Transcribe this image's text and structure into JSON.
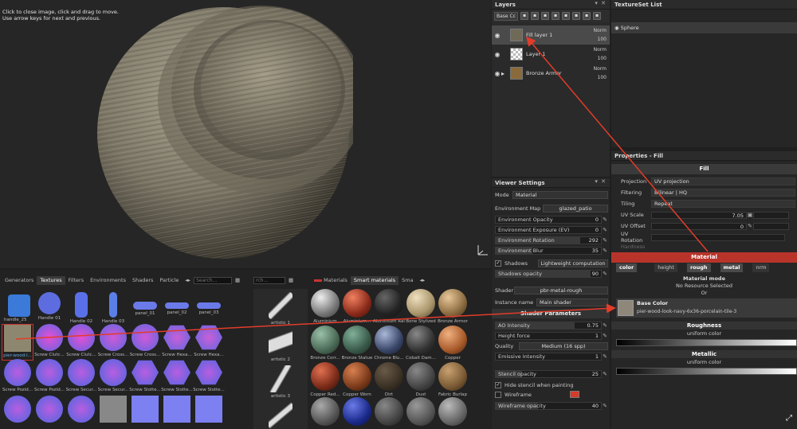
{
  "viewport": {
    "hint_line1": "Click to close image, click and drag to move.",
    "hint_line2": "Use arrow keys for next and previous."
  },
  "layers": {
    "title": "Layers",
    "blend_mode": "Base Cc",
    "items": [
      {
        "name": "Fill layer 1",
        "blend": "Norm",
        "opacity": "100",
        "selected": true
      },
      {
        "name": "Layer 1",
        "blend": "Norm",
        "opacity": "100",
        "selected": false
      },
      {
        "name": "Bronze Armor",
        "blend": "Norm",
        "opacity": "100",
        "selected": false
      }
    ]
  },
  "texset": {
    "title": "TextureSet List",
    "items": [
      "Sphere"
    ]
  },
  "properties": {
    "title": "Properties - Fill",
    "fill_head": "Fill",
    "projection_label": "Projection",
    "projection_value": "UV projection",
    "filtering_label": "Filtering",
    "filtering_value": "Bilinear | HQ",
    "tiling_label": "Tiling",
    "tiling_value": "Repeat",
    "uvscale_label": "UV Scale",
    "uvscale_value": "7.05",
    "uvoffset_label": "UV Offset",
    "uvoffset_value": "0",
    "uvrotation_label": "UV Rotation",
    "hardness_label": "Hardness",
    "material_head": "Material",
    "channels": [
      "color",
      "height",
      "rough",
      "metal",
      "nrm"
    ],
    "material_mode_label": "Material mode",
    "material_mode_value": "No Resource Selected",
    "or_label": "Or",
    "basecolor_label": "Base Color",
    "basecolor_file": "pier-wood-look-navy-6x36-porcelain-tile-3",
    "roughness_label": "Roughness",
    "roughness_sub": "uniform color",
    "metallic_label": "Metallic",
    "metallic_sub": "uniform color"
  },
  "viewer": {
    "title": "Viewer Settings",
    "mode_label": "Mode",
    "mode_value": "Material",
    "envmap_label": "Environment Map",
    "envmap_value": "glazed_patio",
    "env_opacity_label": "Environment Opacity",
    "env_opacity_value": "0",
    "env_exposure_label": "Environment Exposure (EV)",
    "env_exposure_value": "0",
    "env_rotation_label": "Environment Rotation",
    "env_rotation_value": "292",
    "env_blur_label": "Environment Blur",
    "env_blur_value": "35",
    "shadows_label": "Shadows",
    "shadows_value": "Lightweight computation",
    "shadows_opacity_label": "Shadows opacity",
    "shadows_opacity_value": "90",
    "shader_label": "Shader",
    "shader_value": "pbr-metal-rough",
    "instance_label": "Instance name",
    "instance_value": "Main shader",
    "shader_params_head": "Shader Parameters",
    "ao_label": "AO Intensity",
    "ao_value": "0.75",
    "height_force_label": "Height force",
    "height_force_value": "1",
    "quality_label": "Quality",
    "quality_value": "Medium (16 spp)",
    "emissive_label": "Emissive Intensity",
    "emissive_value": "1",
    "stencil_label": "Stencil opacity",
    "stencil_value": "25",
    "hide_stencil_label": "Hide stencil when painting",
    "wireframe_label": "Wireframe",
    "wireframe_opacity_label": "Wireframe opacity",
    "wireframe_opacity_value": "40",
    "wireframe_color": "#d83a2a"
  },
  "shelf": {
    "tabs": [
      "Generators",
      "Textures",
      "Filters",
      "Environments",
      "Shaders",
      "Particle"
    ],
    "search_placeholder": "Search...",
    "search2_placeholder": "rch...",
    "mat_tabs": [
      "Materials",
      "Smart materials",
      "Sma"
    ],
    "icons": [
      [
        "",
        "Handle 01",
        "Handle 02",
        "Handle 03",
        "panel_01",
        "panel_02",
        "panel_03"
      ],
      [
        "pier-wood-l...",
        "Screw Clutc...",
        "Screw Clutc...",
        "Screw Cross...",
        "Screw Cross...",
        "Screw Hexa...",
        "Screw Hexa..."
      ],
      [
        "Screw Pozid...",
        "Screw Pozid...",
        "Screw Secur...",
        "Screw Secur...",
        "Screw Slotte...",
        "Screw Slotte...",
        "Screw Slotte..."
      ]
    ],
    "handle_label": "handle_25",
    "alphas": [
      "artistic 1",
      "artistic 2",
      "artistic 3"
    ],
    "materials": [
      [
        "Aluminium",
        "Aluminium...",
        "Aluminium Ral...",
        "Bone Stylized",
        "Bronze Armor"
      ],
      [
        "Bronze Corr...",
        "Bronze Statue",
        "Chrome Blu...",
        "Cobalt Dam...",
        "Copper"
      ],
      [
        "Copper Red...",
        "Copper Worn",
        "Dirt",
        "Dust",
        "Fabric Burlap"
      ]
    ]
  }
}
